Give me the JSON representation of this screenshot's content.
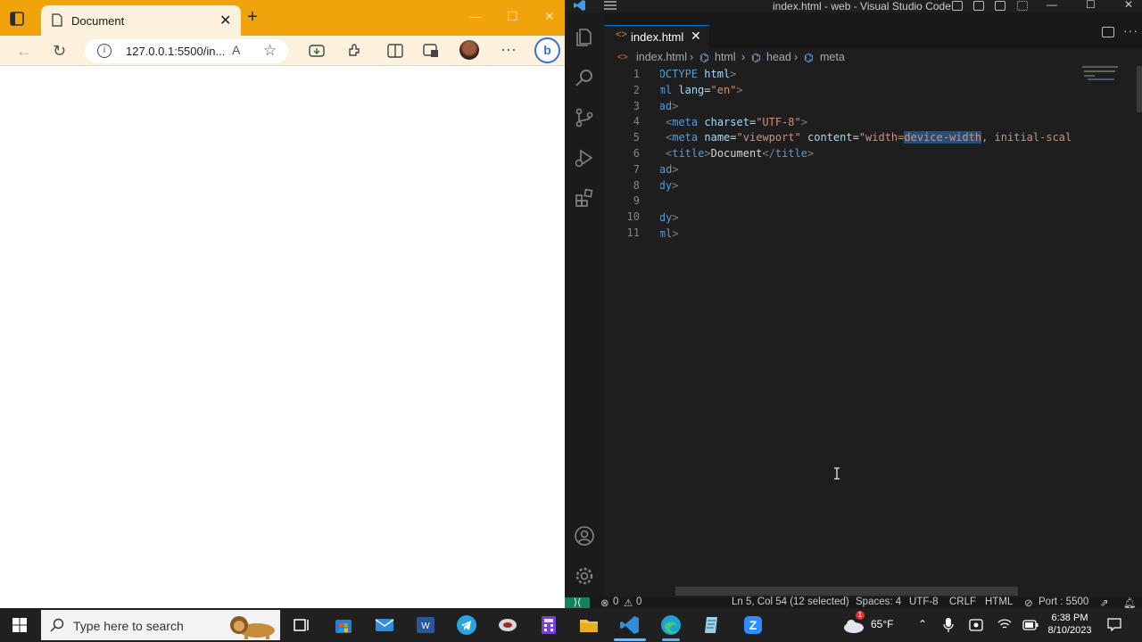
{
  "browser": {
    "tab_title": "Document",
    "address": "127.0.0.1:5500/in...",
    "read_aloud": "A⁶"
  },
  "vscode": {
    "title": "index.html - web - Visual Studio Code",
    "tab_name": "index.html",
    "breadcrumb": [
      "index.html",
      "html",
      "head",
      "meta"
    ],
    "lines": [
      {
        "n": "1"
      },
      {
        "n": "2"
      },
      {
        "n": "3"
      },
      {
        "n": "4"
      },
      {
        "n": "5"
      },
      {
        "n": "6"
      },
      {
        "n": "7"
      },
      {
        "n": "8"
      },
      {
        "n": "9"
      },
      {
        "n": "10"
      },
      {
        "n": "11"
      }
    ],
    "code": {
      "l1": [
        "<!",
        "DOCTYPE",
        " ",
        "html",
        ">"
      ],
      "l2": [
        "<",
        "html",
        " ",
        "lang",
        "=",
        "\"en\"",
        ">"
      ],
      "l3": [
        "<",
        "head",
        ">"
      ],
      "l4": [
        "<",
        "meta",
        " ",
        "charset",
        "=",
        "\"UTF-8\"",
        ">"
      ],
      "l5": [
        "<",
        "meta",
        " ",
        "name",
        "=",
        "\"viewport\"",
        " ",
        "content",
        "=",
        "\"width=",
        "device-width",
        ", initial-scal"
      ],
      "l6": [
        "<",
        "title",
        ">",
        "Document",
        "</",
        "title",
        ">"
      ],
      "l7": [
        "</",
        "head",
        ">"
      ],
      "l8": [
        "<",
        "body",
        ">"
      ],
      "l10": [
        "</",
        "body",
        ">"
      ],
      "l11": [
        "</",
        "html",
        ">"
      ]
    },
    "status": {
      "errors": "0",
      "warnings": "0",
      "position": "Ln 5, Col 54 (12 selected)",
      "spaces": "Spaces: 4",
      "encoding": "UTF-8",
      "eol": "CRLF",
      "language": "HTML",
      "port": "Port : 5500"
    }
  },
  "taskbar": {
    "search_placeholder": "Type here to search",
    "weather": "65°F",
    "weather_badge": "1",
    "time": "6:38 PM",
    "date": "8/10/2023"
  }
}
